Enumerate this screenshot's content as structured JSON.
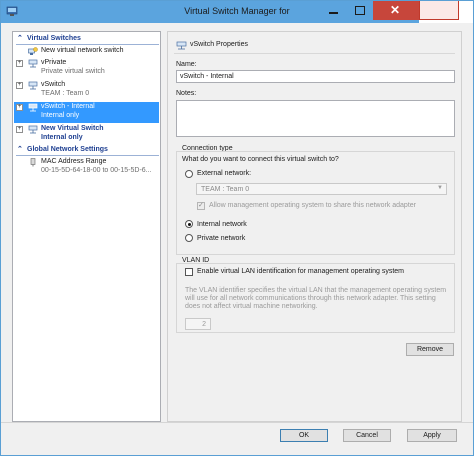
{
  "window": {
    "title": "Virtual Switch Manager for"
  },
  "tree": {
    "virtual_switches_header": "Virtual Switches",
    "global_settings_header": "Global Network Settings",
    "nodes": [
      {
        "main": "New virtual network switch",
        "sub": "",
        "icon": "new-switch-icon"
      },
      {
        "main": "vPrivate",
        "sub": "Private virtual switch",
        "icon": "network-switch-icon"
      },
      {
        "main": "vSwitch",
        "sub": "TEAM : Team 0",
        "icon": "network-switch-icon"
      },
      {
        "main": "vSwitch - Internal",
        "sub": "Internal only",
        "icon": "network-switch-icon"
      },
      {
        "main": "New Virtual Switch",
        "sub": "Internal only",
        "icon": "network-switch-icon"
      }
    ],
    "mac_range": {
      "main": "MAC Address Range",
      "sub": "00-15-5D-64-18-00 to 00-15-5D-6..."
    }
  },
  "props": {
    "header": "vSwitch Properties",
    "name_label": "Name:",
    "name_value": "vSwitch - Internal",
    "notes_label": "Notes:",
    "notes_value": "",
    "connection_type_label": "Connection type",
    "connection_question": "What do you want to connect this virtual switch to?",
    "external_label": "External network:",
    "external_selected": "TEAM : Team 0",
    "allow_mgmt_label": "Allow management operating system to share this network adapter",
    "internal_label": "Internal network",
    "private_label": "Private network",
    "selected_connection": "internal",
    "vlan_label": "VLAN ID",
    "vlan_enable_label": "Enable virtual LAN identification for management operating system",
    "vlan_description": "The VLAN identifier specifies the virtual LAN that the management operating system will use for all network communications through this network adapter. This setting does not affect virtual machine networking.",
    "vlan_value": "2",
    "remove_label": "Remove"
  },
  "footer": {
    "ok_label": "OK",
    "cancel_label": "Cancel",
    "apply_label": "Apply"
  },
  "colors": {
    "titlebar": "#5ba4de",
    "selection": "#3399ff",
    "section_text": "#1e3f91",
    "close_button": "#c7463b"
  }
}
